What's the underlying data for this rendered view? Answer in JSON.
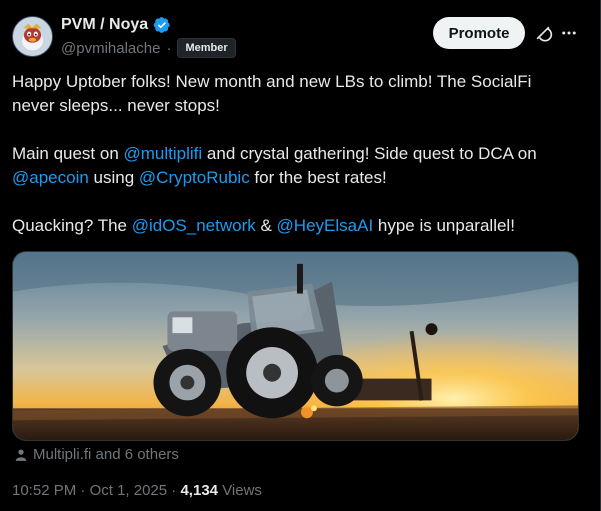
{
  "author": {
    "display_name": "PVM / Noya",
    "handle": "@pvmihalache",
    "separator": "·",
    "badge": "Member",
    "verified": true
  },
  "header": {
    "promote_label": "Promote",
    "grok_icon": "grok-icon",
    "more_icon": "more-icon"
  },
  "tweet": {
    "para1": "Happy Uptober folks! New month and new LBs to climb! The SocialFi never sleeps... never stops!",
    "para2": {
      "t1": "Main quest on ",
      "m1": "@multiplifi",
      "t2": " and crystal gathering! Side quest to DCA on ",
      "m2": "@apecoin",
      "t3": " using ",
      "m3": "@CryptoRubic",
      "t4": " for the best rates!"
    },
    "para3": {
      "t1": "Quacking? The ",
      "m1": "@idOS_network",
      "t2": " & ",
      "m2": "@HeyElsaAI",
      "t3": " hype is unparallel!"
    }
  },
  "media": {
    "description_icon": "tractor-sunset-photo"
  },
  "tagged": {
    "icon": "person-icon",
    "text": "Multipli.fi and 6 others"
  },
  "meta": {
    "time": "10:52 PM",
    "date": "Oct 1, 2025",
    "sep": "·",
    "views_count": "4,134",
    "views_label": "Views"
  },
  "colors": {
    "background": "#000000",
    "text": "#e7e9ea",
    "secondary": "#71767b",
    "link": "#1d9bf0",
    "verified": "#1d9bf0",
    "promote_bg": "#eff3f4"
  }
}
